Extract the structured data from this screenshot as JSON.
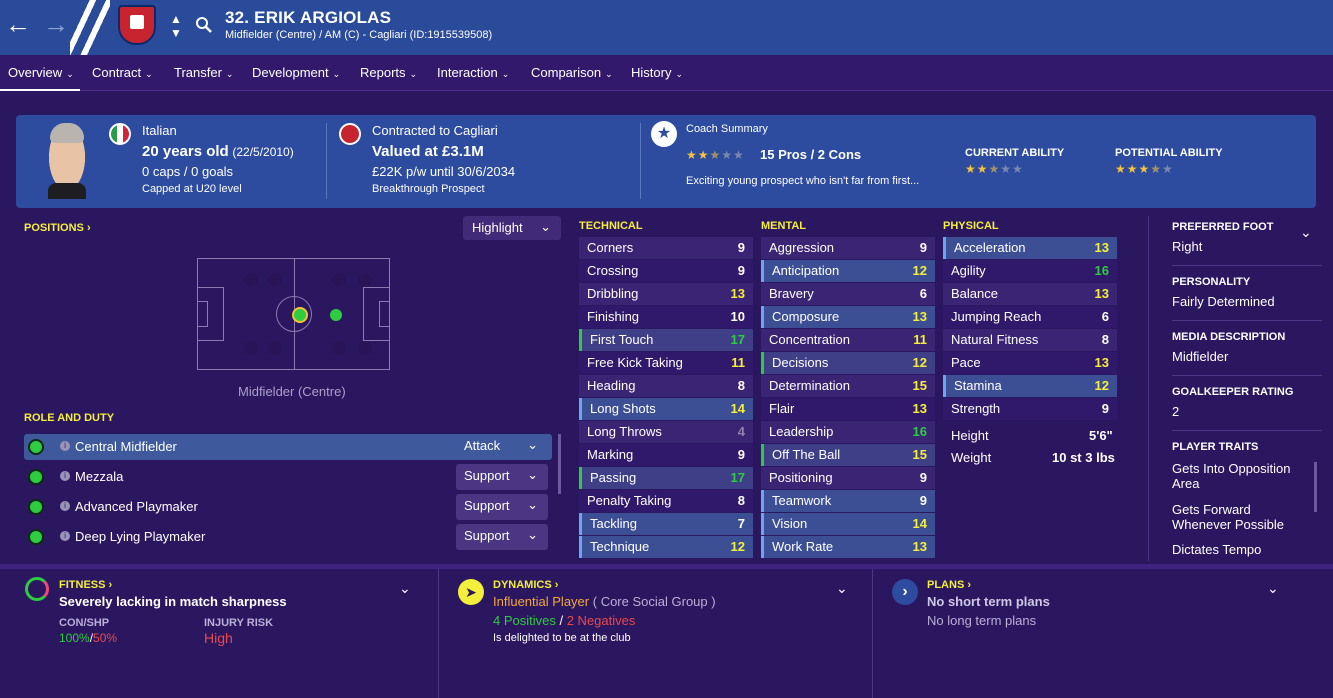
{
  "header": {
    "name": "32. ERIK ARGIOLAS",
    "subtitle": "Midfielder (Centre) / AM (C) - Cagliari (ID:1915539508)"
  },
  "tabs": [
    {
      "label": "Overview"
    },
    {
      "label": "Contract"
    },
    {
      "label": "Transfer"
    },
    {
      "label": "Development"
    },
    {
      "label": "Reports"
    },
    {
      "label": "Interaction"
    },
    {
      "label": "Comparison"
    },
    {
      "label": "History"
    }
  ],
  "summary": {
    "nationality": "Italian",
    "age": "20 years old",
    "dob": "(22/5/2010)",
    "caps": "0 caps / 0 goals",
    "capped": "Capped at U20 level",
    "club": "Contracted to Cagliari",
    "value": "Valued at £3.1M",
    "wage": "£22K p/w until 30/6/2034",
    "status": "Breakthrough Prospect",
    "coach_title": "Coach Summary",
    "pros_cons": "15 Pros / 2 Cons",
    "coach_text": "Exciting young prospect who isn't far from first...",
    "coach_stars": 2.5,
    "ca_label": "CURRENT ABILITY",
    "ca_stars": 2.5,
    "pa_label": "POTENTIAL ABILITY",
    "pa_stars": 3.5
  },
  "positions": {
    "title": "POSITIONS ›",
    "highlight": "Highlight",
    "label": "Midfielder (Centre)"
  },
  "roles": {
    "title": "ROLE AND DUTY",
    "items": [
      {
        "name": "Central Midfielder",
        "duty": "Attack"
      },
      {
        "name": "Mezzala",
        "duty": "Support"
      },
      {
        "name": "Advanced Playmaker",
        "duty": "Support"
      },
      {
        "name": "Deep Lying Playmaker",
        "duty": "Support"
      }
    ]
  },
  "technical": {
    "title": "TECHNICAL",
    "items": [
      [
        "Corners",
        "9"
      ],
      [
        "Crossing",
        "9"
      ],
      [
        "Dribbling",
        "13"
      ],
      [
        "Finishing",
        "10"
      ],
      [
        "First Touch",
        "17"
      ],
      [
        "Free Kick Taking",
        "11"
      ],
      [
        "Heading",
        "8"
      ],
      [
        "Long Shots",
        "14"
      ],
      [
        "Long Throws",
        "4"
      ],
      [
        "Marking",
        "9"
      ],
      [
        "Passing",
        "17"
      ],
      [
        "Penalty Taking",
        "8"
      ],
      [
        "Tackling",
        "7"
      ],
      [
        "Technique",
        "12"
      ]
    ]
  },
  "mental": {
    "title": "MENTAL",
    "items": [
      [
        "Aggression",
        "9"
      ],
      [
        "Anticipation",
        "12"
      ],
      [
        "Bravery",
        "6"
      ],
      [
        "Composure",
        "13"
      ],
      [
        "Concentration",
        "11"
      ],
      [
        "Decisions",
        "12"
      ],
      [
        "Determination",
        "15"
      ],
      [
        "Flair",
        "13"
      ],
      [
        "Leadership",
        "16"
      ],
      [
        "Off The Ball",
        "15"
      ],
      [
        "Positioning",
        "9"
      ],
      [
        "Teamwork",
        "9"
      ],
      [
        "Vision",
        "14"
      ],
      [
        "Work Rate",
        "13"
      ]
    ]
  },
  "physical": {
    "title": "PHYSICAL",
    "items": [
      [
        "Acceleration",
        "13"
      ],
      [
        "Agility",
        "16"
      ],
      [
        "Balance",
        "13"
      ],
      [
        "Jumping Reach",
        "6"
      ],
      [
        "Natural Fitness",
        "8"
      ],
      [
        "Pace",
        "13"
      ],
      [
        "Stamina",
        "12"
      ],
      [
        "Strength",
        "9"
      ]
    ],
    "height_label": "Height",
    "height": "5'6\"",
    "weight_label": "Weight",
    "weight": "10 st 3 lbs"
  },
  "side": [
    {
      "t": "PREFERRED FOOT",
      "d": "Right"
    },
    {
      "t": "PERSONALITY",
      "d": "Fairly Determined"
    },
    {
      "t": "MEDIA DESCRIPTION",
      "d": "Midfielder"
    },
    {
      "t": "GOALKEEPER RATING",
      "d": "2"
    },
    {
      "t": "PLAYER TRAITS",
      "d": "Gets Into Opposition Area"
    }
  ],
  "traits": [
    "Gets Forward Whenever Possible",
    "Dictates Tempo"
  ],
  "fitness": {
    "title": "FITNESS ›",
    "text": "Severely lacking in match sharpness",
    "con_label": "CON/SHP",
    "con": "100%",
    "shp": "50%",
    "inj_label": "INJURY RISK",
    "inj": "High"
  },
  "dynamics": {
    "title": "DYNAMICS ›",
    "role": "Influential Player",
    "group": "( Core Social Group )",
    "pos": "4 Positives",
    "neg": "2 Negatives",
    "text": "Is delighted to be at the club"
  },
  "plans": {
    "title": "PLANS ›",
    "a": "No short term plans",
    "b": "No long term plans"
  }
}
